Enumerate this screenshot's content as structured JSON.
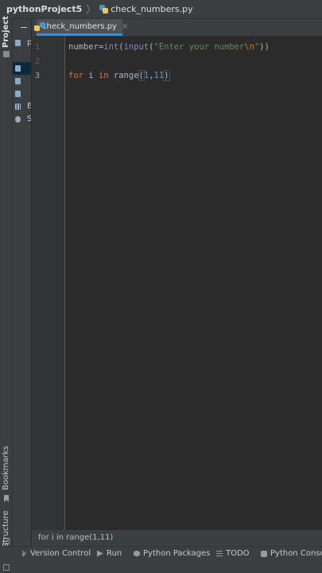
{
  "titlebar": {
    "project": "pythonProject5",
    "separator": "〉",
    "file": "check_numbers.py",
    "file_icon": "python-file-icon"
  },
  "leftstrip": {
    "project_label": "Project",
    "bookmarks_label": "Bookmarks",
    "structure_label": "Structure"
  },
  "tree": {
    "items": [
      {
        "label": "p"
      },
      {
        "label": ""
      },
      {
        "label": ""
      },
      {
        "label": ""
      },
      {
        "label": "E"
      },
      {
        "label": "S"
      }
    ]
  },
  "tab": {
    "label": "check_numbers.py",
    "close": "×"
  },
  "editor": {
    "line_numbers": [
      "1",
      "2",
      "3"
    ],
    "current_line": "3",
    "line1": {
      "var": "number",
      "eq": "=",
      "fn1": "int",
      "p1": "(",
      "fn2": "input",
      "p2": "(",
      "str1": "\"Enter your number",
      "esc": "\\n",
      "str2": "\"",
      "p3": "))"
    },
    "line3": {
      "kw1": "for",
      "var": " i ",
      "kw2": "in",
      "fn": " range",
      "open": "(",
      "n1": "1",
      "comma": ",",
      "n2": "11",
      "close": ")"
    }
  },
  "statusline": {
    "text": "for i in range(1,11)"
  },
  "bottombar": {
    "version_control": "Version Control",
    "run": "Run",
    "python_packages": "Python Packages",
    "todo": "TODO",
    "python_console": "Python Console"
  },
  "colors": {
    "background": "#2b2b2b",
    "panel": "#3c3f41",
    "keyword": "#cc7832",
    "string": "#6a8759",
    "number": "#6897bb",
    "builtin": "#8888c6"
  }
}
